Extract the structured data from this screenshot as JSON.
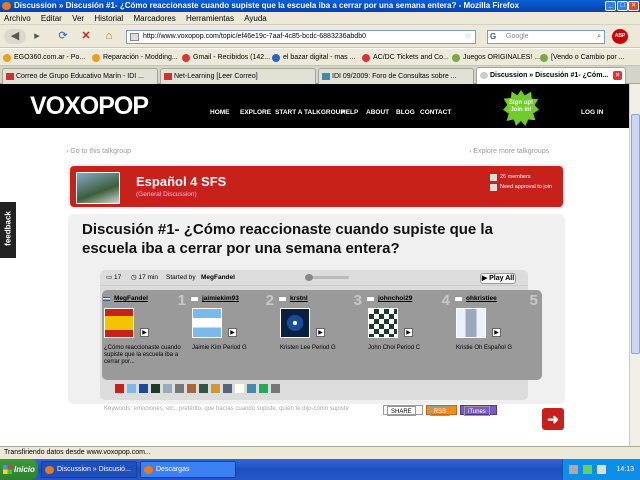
{
  "window": {
    "title": "Discussion » Discusión #1- ¿Cómo reaccionaste cuando supiste que la escuela iba a cerrar por una semana entera? - Mozilla Firefox"
  },
  "menu": [
    "Archivo",
    "Editar",
    "Ver",
    "Historial",
    "Marcadores",
    "Herramientas",
    "Ayuda"
  ],
  "nav": {
    "url": "http://www.voxopop.com/topic/ef46e19c-7aaf-4c85-bcdc-6883236abdb0",
    "search_placeholder": "Google"
  },
  "bookmarks": [
    "EGO360.com.ar - Po...",
    "Reparación - Modding...",
    "Gmail - Recibidos (142...",
    "el bazar digital - mas ...",
    "AC/DC Tickets and Co...",
    "Juegos ORIGINALES! ...",
    "[Vendo o Cambio por ..."
  ],
  "tabs": [
    {
      "label": "Correo de Grupo Educativo Marín - IDI ..."
    },
    {
      "label": "Net-Learning [Leer Correo]"
    },
    {
      "label": "IDI 09/2009: Foro de Consultas sobre ..."
    },
    {
      "label": "Discussion » Discusión #1- ¿Cóm..."
    }
  ],
  "site": {
    "logo": "VOXOPOP",
    "nav": [
      "HOME",
      "EXPLORE",
      "START A TALKGROUP",
      "HELP",
      "ABOUT",
      "BLOG",
      "CONTACT"
    ],
    "signup": "Sign up! Join in!",
    "login": "LOG IN",
    "back_link": "› Go to this talkgroup",
    "explore_link": "› Explore more talkgroups",
    "feedback": "feedback"
  },
  "group": {
    "name": "Español 4 SFS",
    "sub": "(General Discussion)",
    "members": "26 members",
    "approval": "Need approval to join"
  },
  "discussion": {
    "title": "Discusión #1- ¿Cómo reaccionaste cuando supiste que la escuela iba a cerrar por una semana entera?",
    "replies": "17",
    "duration": "17 min",
    "started_label": "Started by",
    "started_by": "MegFandel",
    "play_all": "Play All"
  },
  "posts": [
    {
      "user": "MegFandel",
      "num": "1",
      "caption": "¿Cómo reaccionaste cuando supiste que la escuela iba a cerrar por...",
      "flag": "us"
    },
    {
      "user": "jaimiekim93",
      "num": "2",
      "caption": "Jaimie Kim Period G",
      "flag": "kr"
    },
    {
      "user": "krstnl",
      "num": "3",
      "caption": "Kristen Lee Period G",
      "flag": "kr"
    },
    {
      "user": "johnchoi29",
      "num": "4",
      "caption": "John Choi Period C",
      "flag": "kr"
    },
    {
      "user": "ohkristiee",
      "num": "5",
      "caption": "Kristie Oh Español G",
      "flag": "kr"
    }
  ],
  "footer": {
    "keywords": "Keywords: emociones, etc., pretérito, que hacías cuando supiste, quién te dijo-cómo supiste",
    "share": "SHARE",
    "rss": "RSS",
    "itunes": "iTunes"
  },
  "status": "Transfiriendo datos desde www.voxopop.com...",
  "taskbar": {
    "start": "Inicio",
    "tasks": [
      "Discussion » Discusió...",
      "Descargas"
    ],
    "clock": "14:13"
  }
}
